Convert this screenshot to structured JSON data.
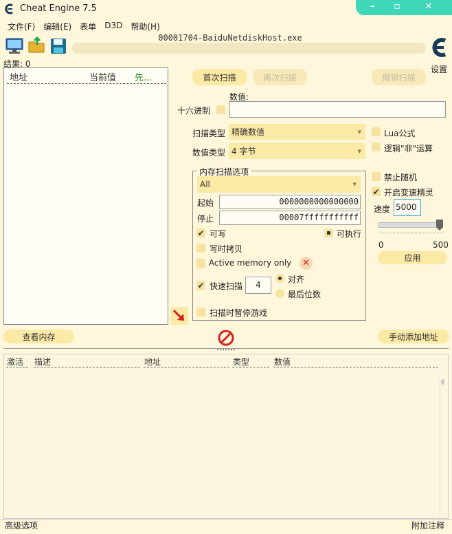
{
  "window": {
    "title": "Cheat Engine 7.5",
    "process": "00001704-BaiduNetdiskHost.exe",
    "controls": {
      "minimize": "–",
      "maximize": "▫",
      "close": "✕"
    },
    "accent": "#3fd7b7"
  },
  "menu": [
    "文件(F)",
    "编辑(E)",
    "表单",
    "D3D",
    "帮助(H)"
  ],
  "settings_label": "设置",
  "results_label": "结果: 0",
  "address_list": {
    "headers": [
      "地址",
      "当前值",
      "先..."
    ]
  },
  "scan_buttons": {
    "first": "首次扫描",
    "next": "再次扫描",
    "undo": "撤销扫描"
  },
  "value": {
    "label": "数值:",
    "hex_label": "十六进制",
    "value": ""
  },
  "scan_type": {
    "label": "扫描类型",
    "selected": "精确数值"
  },
  "value_type": {
    "label": "数值类型",
    "selected": "4 字节"
  },
  "lua_formula": "Lua公式",
  "logical_not": "逻辑\"非\"运算",
  "memory_options": {
    "title": "内存扫描选项",
    "region": "All",
    "start_label": "起始",
    "start_value": "0000000000000000",
    "stop_label": "停止",
    "stop_value": "00007fffffffffff",
    "writable": "可写",
    "executable": "可执行",
    "copy_on_write": "写时拷贝",
    "active_memory": "Active memory only",
    "fast_scan": "快速扫描",
    "fast_scan_value": "4",
    "aligned": "对齐",
    "last_digits": "最后位数",
    "pause_game": "扫描时暂停游戏"
  },
  "disable_random": "禁止随机",
  "speedhack": {
    "label": "开启变速精灵",
    "speed_label": "速度",
    "speed_value": "5000",
    "min": "0",
    "max": "500",
    "apply": "应用"
  },
  "view_memory": "查看内存",
  "add_address": "手动添加地址",
  "cheat_table": {
    "headers": [
      "激活",
      "描述",
      "地址",
      "类型",
      "数值"
    ]
  },
  "footer": {
    "advanced": "高级选项",
    "comments": "附加注释"
  }
}
